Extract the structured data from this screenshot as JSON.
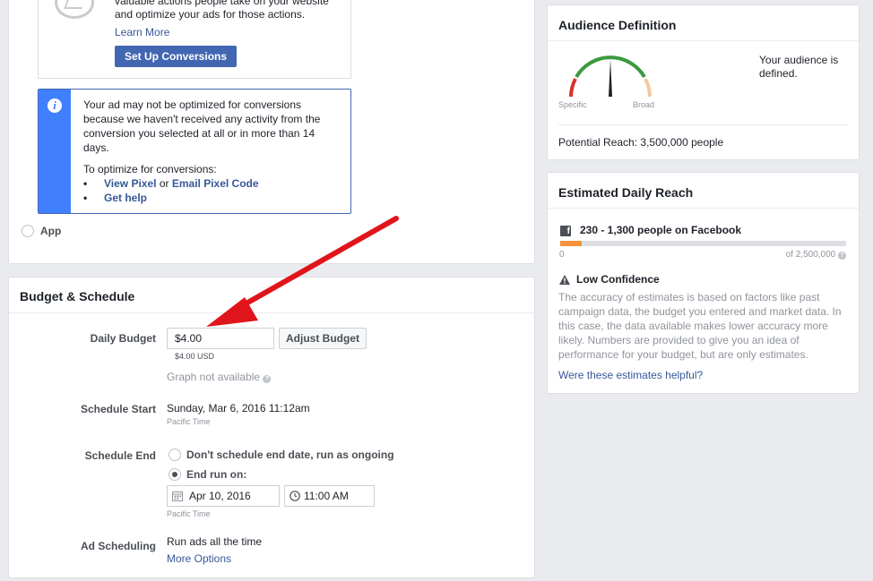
{
  "conversion": {
    "text": "valuable actions people take on your website and optimize your ads for those actions.",
    "learn_more": "Learn More",
    "setup_button": "Set Up Conversions"
  },
  "warning": {
    "text": "Your ad may not be optimized for conversions because we haven't received any activity from the conversion you selected at all or in more than 14 days.",
    "optimize_intro": "To optimize for conversions:",
    "view_pixel": "View Pixel",
    "or": "or",
    "email_pixel": "Email Pixel Code",
    "get_help": "Get help"
  },
  "app_option": {
    "label": "App"
  },
  "budget": {
    "title": "Budget & Schedule",
    "daily_budget_label": "Daily Budget",
    "daily_budget_value": "$4.00",
    "daily_budget_usd": "$4.00 USD",
    "adjust_button": "Adjust Budget",
    "graph_note": "Graph not available",
    "schedule_start_label": "Schedule Start",
    "schedule_start_value": "Sunday, Mar 6, 2016 11:12am",
    "start_timezone": "Pacific Time",
    "schedule_end_label": "Schedule End",
    "end_option_ongoing": "Don't schedule end date, run as ongoing",
    "end_option_date": "End run on:",
    "end_date": "Apr 10, 2016",
    "end_time": "11:00 AM",
    "end_timezone": "Pacific Time",
    "ad_scheduling_label": "Ad Scheduling",
    "ad_scheduling_value": "Run ads all the time",
    "more_options": "More Options"
  },
  "audience": {
    "title": "Audience Definition",
    "gauge_specific": "Specific",
    "gauge_broad": "Broad",
    "status": "Your audience is defined.",
    "potential_reach": "Potential Reach: 3,500,000 people"
  },
  "estimated": {
    "title": "Estimated Daily Reach",
    "reach_range": "230 - 1,300 people on Facebook",
    "bar_fill_fraction": 0.075,
    "bar_min": "0",
    "bar_max": "of 2,500,000",
    "confidence_title": "Low Confidence",
    "confidence_text": "The accuracy of estimates is based on factors like past campaign data, the budget you entered and market data. In this case, the data available makes lower accuracy more likely. Numbers are provided to give you an idea of performance for your budget, but are only estimates.",
    "helpful_link": "Were these estimates helpful?"
  },
  "colors": {
    "brand_blue": "#4267b2",
    "info_blue": "#4080ff",
    "link": "#365899",
    "arrow_red": "#e0151b",
    "bar_orange": "#f7923b"
  }
}
